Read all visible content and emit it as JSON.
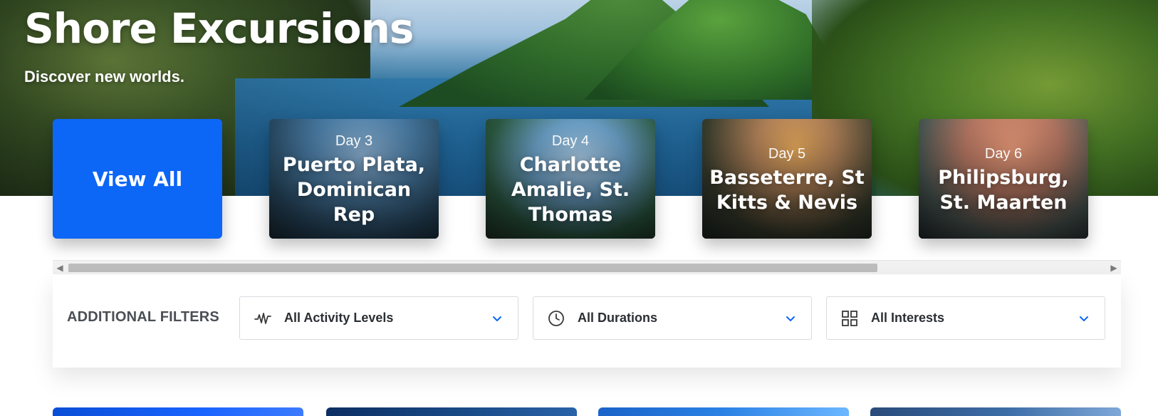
{
  "hero": {
    "title": "Shore Excursions",
    "subtitle": "Discover new worlds."
  },
  "carousel": {
    "view_all_label": "View All",
    "cards": [
      {
        "day_label": "Day 3",
        "port": "Puerto Plata, Dominican Rep"
      },
      {
        "day_label": "Day 4",
        "port": "Charlotte Amalie, St. Thomas"
      },
      {
        "day_label": "Day 5",
        "port": "Basseterre, St Kitts & Nevis"
      },
      {
        "day_label": "Day 6",
        "port": "Philipsburg, St. Maarten"
      }
    ],
    "scroll_position": 0.78
  },
  "filters": {
    "label": "ADDITIONAL FILTERS",
    "activity": {
      "value": "All Activity Levels",
      "icon": "activity-wave-icon"
    },
    "duration": {
      "value": "All Durations",
      "icon": "clock-icon"
    },
    "interests": {
      "value": "All Interests",
      "icon": "grid-icon"
    },
    "chevron_icon": "chevron-down-icon"
  },
  "colors": {
    "primary": "#0c66f6",
    "filter_text": "#2b2f33",
    "filter_label": "#4a4f55",
    "chevron": "#0c66f6"
  }
}
